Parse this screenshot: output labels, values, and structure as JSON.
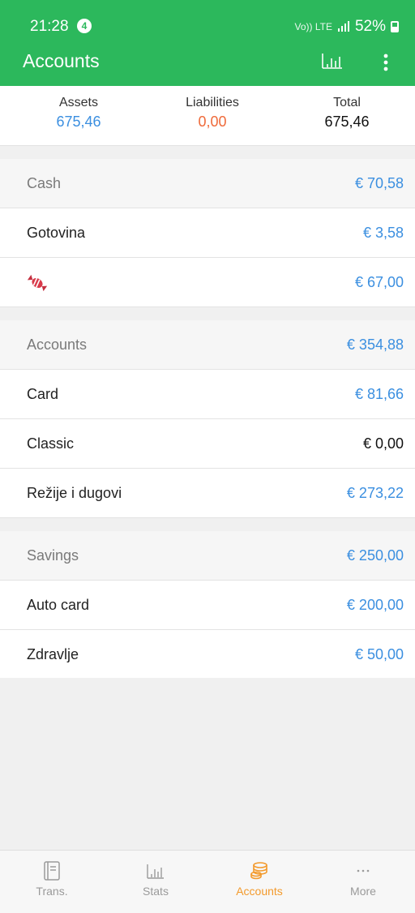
{
  "status_bar": {
    "time": "21:28",
    "notification_count": "4",
    "network": "Vo)) LTE",
    "battery": "52%"
  },
  "app_bar": {
    "title": "Accounts"
  },
  "summary": {
    "assets_label": "Assets",
    "assets_value": "675,46",
    "liabilities_label": "Liabilities",
    "liabilities_value": "0,00",
    "total_label": "Total",
    "total_value": "675,46"
  },
  "groups": [
    {
      "name": "Cash",
      "amount": "€ 70,58",
      "items": [
        {
          "name": "Gotovina",
          "amount": "€ 3,58"
        },
        {
          "name": "",
          "icon": "candy-icon",
          "amount": "€ 67,00"
        }
      ]
    },
    {
      "name": "Accounts",
      "amount": "€ 354,88",
      "items": [
        {
          "name": "Card",
          "amount": "€ 81,66"
        },
        {
          "name": "Classic",
          "amount": "€ 0,00"
        },
        {
          "name": "Režije i dugovi",
          "amount": "€ 273,22"
        }
      ]
    },
    {
      "name": "Savings",
      "amount": "€ 250,00",
      "items": [
        {
          "name": "Auto card",
          "amount": "€ 200,00"
        },
        {
          "name": "Zdravlje",
          "amount": "€ 50,00"
        }
      ]
    }
  ],
  "bottom_nav": [
    {
      "label": "Trans.",
      "icon": "book-icon"
    },
    {
      "label": "Stats",
      "icon": "bar-chart-icon"
    },
    {
      "label": "Accounts",
      "icon": "coins-icon",
      "active": true
    },
    {
      "label": "More",
      "icon": "more-dots-icon"
    }
  ],
  "colors": {
    "brand": "#2cb85c",
    "accent": "#f39a2c",
    "positive": "#3b8fe0",
    "negative": "#ef6a3a"
  }
}
